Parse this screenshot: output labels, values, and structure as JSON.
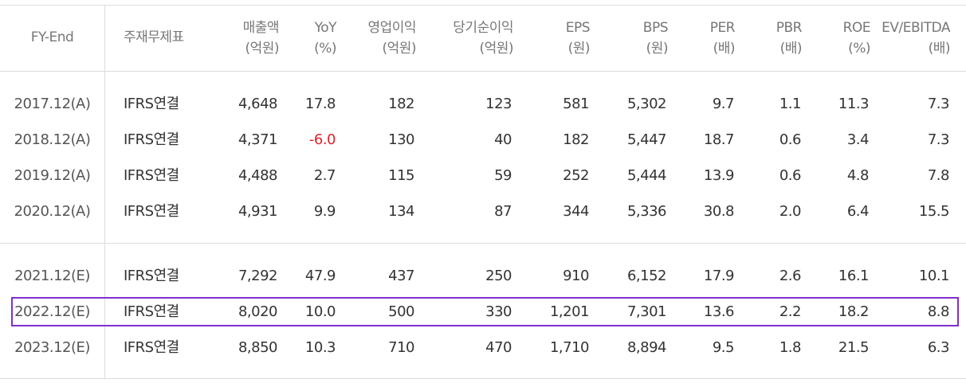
{
  "headers": {
    "fy_end": "FY-End",
    "type": "주재무제표",
    "sales": {
      "l1": "매출액",
      "l2": "(억원)"
    },
    "yoy": {
      "l1": "YoY",
      "l2": "(%)"
    },
    "op": {
      "l1": "영업이익",
      "l2": "(억원)"
    },
    "net": {
      "l1": "당기순이익",
      "l2": "(억원)"
    },
    "eps": {
      "l1": "EPS",
      "l2": "(원)"
    },
    "bps": {
      "l1": "BPS",
      "l2": "(원)"
    },
    "per": {
      "l1": "PER",
      "l2": "(배)"
    },
    "pbr": {
      "l1": "PBR",
      "l2": "(배)"
    },
    "roe": {
      "l1": "ROE",
      "l2": "(%)"
    },
    "ev": {
      "l1": "EV/EBITDA",
      "l2": "(배)"
    }
  },
  "rows": [
    {
      "fy": "2017.12(A)",
      "type": "IFRS연결",
      "sales": "4,648",
      "yoy": "17.8",
      "op": "182",
      "net": "123",
      "eps": "581",
      "bps": "5,302",
      "per": "9.7",
      "pbr": "1.1",
      "roe": "11.3",
      "ev": "7.3"
    },
    {
      "fy": "2018.12(A)",
      "type": "IFRS연결",
      "sales": "4,371",
      "yoy": "-6.0",
      "op": "130",
      "net": "40",
      "eps": "182",
      "bps": "5,447",
      "per": "18.7",
      "pbr": "0.6",
      "roe": "3.4",
      "ev": "7.3"
    },
    {
      "fy": "2019.12(A)",
      "type": "IFRS연결",
      "sales": "4,488",
      "yoy": "2.7",
      "op": "115",
      "net": "59",
      "eps": "252",
      "bps": "5,444",
      "per": "13.9",
      "pbr": "0.6",
      "roe": "4.8",
      "ev": "7.8"
    },
    {
      "fy": "2020.12(A)",
      "type": "IFRS연결",
      "sales": "4,931",
      "yoy": "9.9",
      "op": "134",
      "net": "87",
      "eps": "344",
      "bps": "5,336",
      "per": "30.8",
      "pbr": "2.0",
      "roe": "6.4",
      "ev": "15.5"
    },
    {
      "fy": "2021.12(E)",
      "type": "IFRS연결",
      "sales": "7,292",
      "yoy": "47.9",
      "op": "437",
      "net": "250",
      "eps": "910",
      "bps": "6,152",
      "per": "17.9",
      "pbr": "2.6",
      "roe": "16.1",
      "ev": "10.1"
    },
    {
      "fy": "2022.12(E)",
      "type": "IFRS연결",
      "sales": "8,020",
      "yoy": "10.0",
      "op": "500",
      "net": "330",
      "eps": "1,201",
      "bps": "7,301",
      "per": "13.6",
      "pbr": "2.2",
      "roe": "18.2",
      "ev": "8.8"
    },
    {
      "fy": "2023.12(E)",
      "type": "IFRS연결",
      "sales": "8,850",
      "yoy": "10.3",
      "op": "710",
      "net": "470",
      "eps": "1,710",
      "bps": "8,894",
      "per": "9.5",
      "pbr": "1.8",
      "roe": "21.5",
      "ev": "6.3"
    }
  ],
  "colors": {
    "negative": "#e0212b",
    "highlight_border": "#7f2fd0",
    "grid": "#dcdcdc"
  }
}
